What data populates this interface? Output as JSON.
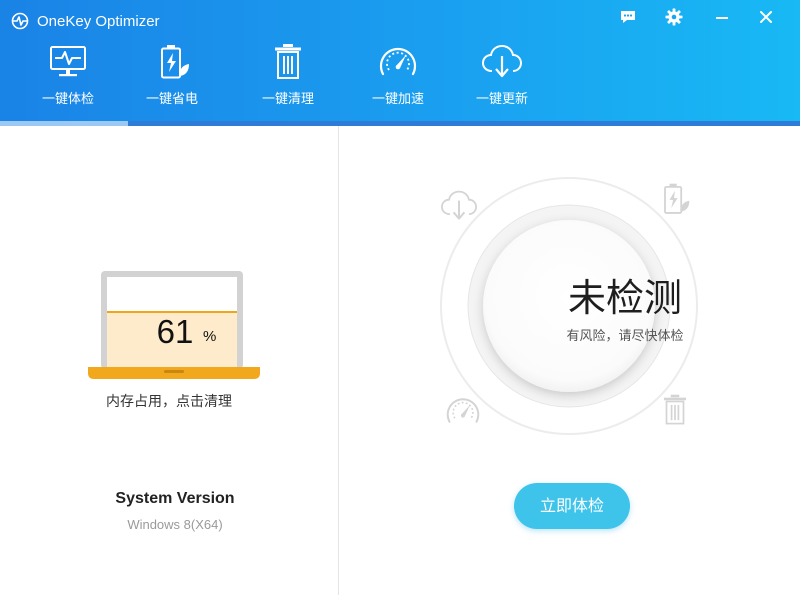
{
  "window": {
    "title": "OneKey Optimizer",
    "controls": [
      "chat-icon",
      "gear-icon",
      "minimize-icon",
      "close-icon"
    ]
  },
  "nav": {
    "tabs": [
      {
        "label": "一键体检",
        "icon": "monitor-pulse-icon",
        "active": true
      },
      {
        "label": "一键省电",
        "icon": "battery-leaf-icon",
        "active": false
      },
      {
        "label": "一键清理",
        "icon": "trash-icon",
        "active": false
      },
      {
        "label": "一键加速",
        "icon": "speedometer-icon",
        "active": false
      },
      {
        "label": "一键更新",
        "icon": "cloud-download-icon",
        "active": false
      }
    ]
  },
  "memory": {
    "value": "61",
    "unit": "%",
    "fill_fraction": 0.61,
    "caption": "内存占用，点击清理"
  },
  "system": {
    "title": "System Version",
    "value": "Windows 8(X64)"
  },
  "status": {
    "title": "未检测",
    "subtitle": "有风险，请尽快体检",
    "button": "立即体检"
  },
  "colors": {
    "header_start": "#1a83e6",
    "header_end": "#18b9f4",
    "laptop_orange": "#f2a81d",
    "button_cyan": "#3ec3ea"
  }
}
